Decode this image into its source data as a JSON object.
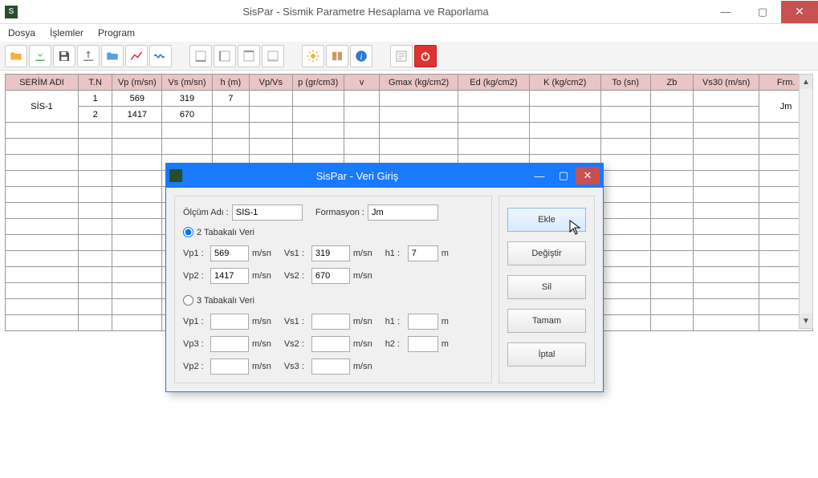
{
  "window": {
    "title": "SisPar - Sismik Parametre Hesaplama ve Raporlama",
    "min": "—",
    "max": "▢",
    "close": "✕"
  },
  "menu": {
    "dosya": "Dosya",
    "islemler": "İşlemler",
    "program": "Program"
  },
  "toolbar_icons": {
    "open": "folder-open-icon",
    "import": "import-icon",
    "save": "save-icon",
    "export": "export-icon",
    "folder": "folder-icon",
    "chart": "chart-icon",
    "wave": "wave-icon",
    "tabA": "tab-a-icon",
    "tabB": "tab-b-icon",
    "tabC": "tab-c-icon",
    "tabD": "tab-d-icon",
    "gear": "gear-icon",
    "book": "book-icon",
    "info": "info-icon",
    "settings": "settings-icon",
    "power": "power-icon"
  },
  "grid": {
    "headers": {
      "serim": "SERİM ADI",
      "tn": "T.N",
      "vp": "Vp (m/sn)",
      "vs": "Vs (m/sn)",
      "h": "h (m)",
      "vpvs": "Vp/Vs",
      "p": "p (gr/cm3)",
      "v": "v",
      "gmax": "Gmax (kg/cm2)",
      "ed": "Ed (kg/cm2)",
      "k": "K (kg/cm2)",
      "to": "To (sn)",
      "zb": "Zb",
      "vs30": "Vs30 (m/sn)",
      "frm": "Frm."
    },
    "rows": [
      {
        "serim": "SİS-1",
        "tn": "1",
        "vp": "569",
        "vs": "319",
        "h": "7",
        "frm": "Jm"
      },
      {
        "serim": "",
        "tn": "2",
        "vp": "1417",
        "vs": "670",
        "h": "",
        "frm": ""
      }
    ]
  },
  "dialog": {
    "title": "SisPar - Veri Giriş",
    "min": "—",
    "max": "▢",
    "close": "✕",
    "labels": {
      "olcum": "Ölçüm Adı :",
      "formasyon": "Formasyon :",
      "r2": "2 Tabakalı Veri",
      "r3": "3 Tabakalı Veri",
      "vp1": "Vp1 :",
      "vs1": "Vs1 :",
      "h1": "h1 :",
      "vp2": "Vp2 :",
      "vs2": "Vs2 :",
      "h2": "h2 :",
      "vp3": "Vp3 :",
      "vs3": "Vs3 :",
      "msn": "m/sn",
      "m": "m"
    },
    "values": {
      "olcum": "SİS-1",
      "formasyon": "Jm",
      "vp1": "569",
      "vs1": "319",
      "h1": "7",
      "vp2": "1417",
      "vs2": "670",
      "b_vp1": "",
      "b_vs1": "",
      "b_h1": "",
      "b_vp3": "",
      "b_vs2": "",
      "b_h2": "",
      "b_vp2": "",
      "b_vs3": ""
    },
    "buttons": {
      "ekle": "Ekle",
      "degistir": "Değiştir",
      "sil": "Sil",
      "tamam": "Tamam",
      "iptal": "İptal"
    }
  }
}
